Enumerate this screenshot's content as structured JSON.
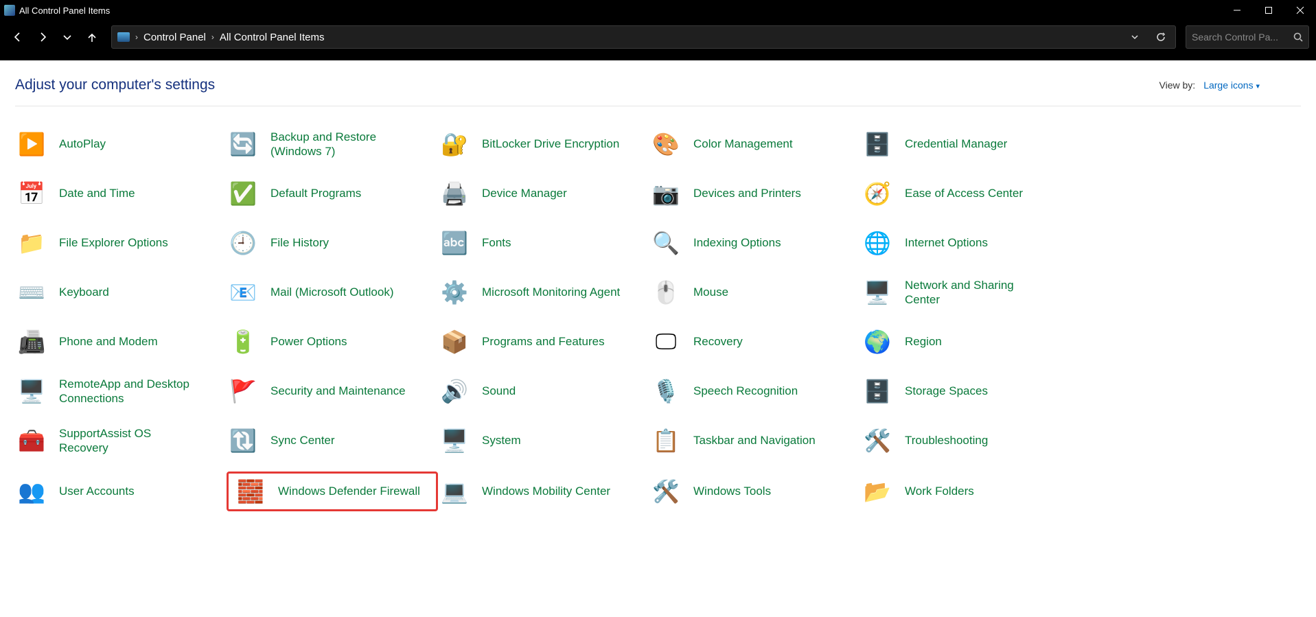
{
  "window": {
    "title": "All Control Panel Items"
  },
  "breadcrumbs": [
    "Control Panel",
    "All Control Panel Items"
  ],
  "search": {
    "placeholder": "Search Control Pa..."
  },
  "header": {
    "title": "Adjust your computer's settings",
    "viewby_label": "View by:",
    "viewby_value": "Large icons"
  },
  "items": [
    {
      "label": "AutoPlay",
      "icon": "autoplay",
      "slug": "autoplay"
    },
    {
      "label": "Backup and Restore (Windows 7)",
      "icon": "backup",
      "slug": "backup-restore"
    },
    {
      "label": "BitLocker Drive Encryption",
      "icon": "bitlocker",
      "slug": "bitlocker"
    },
    {
      "label": "Color Management",
      "icon": "color",
      "slug": "color-management"
    },
    {
      "label": "Credential Manager",
      "icon": "credentials",
      "slug": "credential-manager"
    },
    {
      "label": "Date and Time",
      "icon": "datetime",
      "slug": "date-time"
    },
    {
      "label": "Default Programs",
      "icon": "defaults",
      "slug": "default-programs"
    },
    {
      "label": "Device Manager",
      "icon": "device-manager",
      "slug": "device-manager"
    },
    {
      "label": "Devices and Printers",
      "icon": "printers",
      "slug": "devices-printers"
    },
    {
      "label": "Ease of Access Center",
      "icon": "ease",
      "slug": "ease-of-access"
    },
    {
      "label": "File Explorer Options",
      "icon": "folder-options",
      "slug": "file-explorer-options"
    },
    {
      "label": "File History",
      "icon": "file-history",
      "slug": "file-history"
    },
    {
      "label": "Fonts",
      "icon": "fonts",
      "slug": "fonts"
    },
    {
      "label": "Indexing Options",
      "icon": "indexing",
      "slug": "indexing-options"
    },
    {
      "label": "Internet Options",
      "icon": "internet",
      "slug": "internet-options"
    },
    {
      "label": "Keyboard",
      "icon": "keyboard",
      "slug": "keyboard"
    },
    {
      "label": "Mail (Microsoft Outlook)",
      "icon": "mail",
      "slug": "mail"
    },
    {
      "label": "Microsoft Monitoring Agent",
      "icon": "monitoring",
      "slug": "monitoring-agent"
    },
    {
      "label": "Mouse",
      "icon": "mouse",
      "slug": "mouse"
    },
    {
      "label": "Network and Sharing Center",
      "icon": "network",
      "slug": "network-sharing"
    },
    {
      "label": "Phone and Modem",
      "icon": "modem",
      "slug": "phone-modem"
    },
    {
      "label": "Power Options",
      "icon": "power",
      "slug": "power-options"
    },
    {
      "label": "Programs and Features",
      "icon": "programs",
      "slug": "programs-features"
    },
    {
      "label": "Recovery",
      "icon": "recovery",
      "slug": "recovery"
    },
    {
      "label": "Region",
      "icon": "region",
      "slug": "region"
    },
    {
      "label": "RemoteApp and Desktop Connections",
      "icon": "remoteapp",
      "slug": "remoteapp"
    },
    {
      "label": "Security and Maintenance",
      "icon": "security",
      "slug": "security-maintenance"
    },
    {
      "label": "Sound",
      "icon": "sound",
      "slug": "sound"
    },
    {
      "label": "Speech Recognition",
      "icon": "speech",
      "slug": "speech-recognition"
    },
    {
      "label": "Storage Spaces",
      "icon": "storage",
      "slug": "storage-spaces"
    },
    {
      "label": "SupportAssist OS Recovery",
      "icon": "support-assist",
      "slug": "supportassist"
    },
    {
      "label": "Sync Center",
      "icon": "sync",
      "slug": "sync-center"
    },
    {
      "label": "System",
      "icon": "system",
      "slug": "system"
    },
    {
      "label": "Taskbar and Navigation",
      "icon": "taskbar",
      "slug": "taskbar-navigation"
    },
    {
      "label": "Troubleshooting",
      "icon": "troubleshoot",
      "slug": "troubleshooting"
    },
    {
      "label": "User Accounts",
      "icon": "users",
      "slug": "user-accounts"
    },
    {
      "label": "Windows Defender Firewall",
      "icon": "firewall",
      "slug": "windows-defender-firewall",
      "highlight": true
    },
    {
      "label": "Windows Mobility Center",
      "icon": "mobility",
      "slug": "mobility-center"
    },
    {
      "label": "Windows Tools",
      "icon": "tools",
      "slug": "windows-tools"
    },
    {
      "label": "Work Folders",
      "icon": "work-folders",
      "slug": "work-folders"
    }
  ],
  "icon_glyphs": {
    "autoplay": "▶️",
    "backup": "🔄",
    "bitlocker": "🔐",
    "color": "🎨",
    "credentials": "🗄️",
    "datetime": "📅",
    "defaults": "✅",
    "device-manager": "🖨️",
    "printers": "📷",
    "ease": "🧭",
    "folder-options": "📁",
    "file-history": "🕘",
    "fonts": "🔤",
    "indexing": "🔍",
    "internet": "🌐",
    "keyboard": "⌨️",
    "mail": "📧",
    "monitoring": "⚙️",
    "mouse": "🖱️",
    "network": "🖥️",
    "modem": "📠",
    "power": "🔋",
    "programs": "📦",
    "recovery": "🖵",
    "region": "🌍",
    "remoteapp": "🖥️",
    "security": "🚩",
    "sound": "🔊",
    "speech": "🎙️",
    "storage": "🗄️",
    "support-assist": "🧰",
    "sync": "🔃",
    "system": "🖥️",
    "taskbar": "📋",
    "troubleshoot": "🛠️",
    "users": "👥",
    "firewall": "🧱",
    "mobility": "💻",
    "tools": "🛠️",
    "work-folders": "📂"
  }
}
